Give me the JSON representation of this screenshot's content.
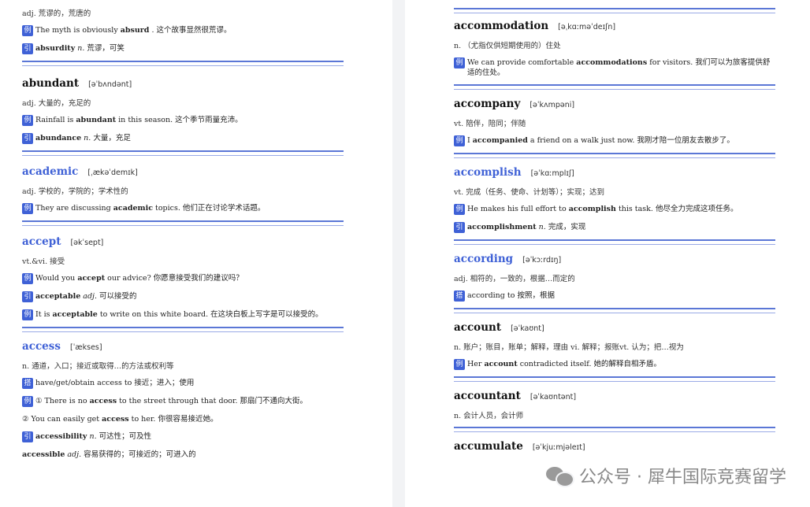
{
  "left": {
    "top_def": "adj. 荒谬的，荒唐的",
    "top_ex": {
      "tag": "例",
      "pre": "The myth is obviously ",
      "bold": "absurd",
      "post": " . 这个故事显然很荒谬。"
    },
    "top_der": {
      "tag": "引",
      "bold": "absurdity",
      "pos": " n.",
      "post": " 荒谬，可笑"
    },
    "abundant": {
      "word": "abundant",
      "ipa": "[əˈbʌndənt]",
      "def": "adj. 大量的，充足的",
      "ex": {
        "tag": "例",
        "pre": "Rainfall is ",
        "bold": "abundant",
        "post": " in this season. 这个季节雨量充沛。"
      },
      "der": {
        "tag": "引",
        "bold": "abundance",
        "pos": " n.",
        "post": " 大量，充足"
      }
    },
    "academic": {
      "word": "academic",
      "ipa": "[ˌækəˈdemɪk]",
      "def": "adj. 学校的，学院的；学术性的",
      "ex": {
        "tag": "例",
        "pre": "They are discussing ",
        "bold": "academic",
        "post": " topics. 他们正在讨论学术话题。"
      }
    },
    "accept": {
      "word": "accept",
      "ipa": "[əkˈsept]",
      "def": "vt.&vi. 接受",
      "ex": {
        "tag": "例",
        "pre": "Would you ",
        "bold": "accept",
        "post": " our advice? 你愿意接受我们的建议吗？"
      },
      "der": {
        "tag": "引",
        "bold": "acceptable",
        "pos": " adj.",
        "post": " 可以接受的"
      },
      "ex2": {
        "tag": "例",
        "pre": "It is ",
        "bold": "acceptable",
        "post": " to write on this white board. 在这块白板上写字是可以接受的。"
      }
    },
    "access": {
      "word": "access",
      "ipa": "[ˈækses]",
      "def": "n. 通道，入口；接近或取得…的方法或权利等",
      "col": {
        "tag": "搭",
        "text": "have/get/obtain access to 接近；进入；使用"
      },
      "ex": {
        "tag": "例",
        "pre": "① There is no ",
        "bold": "access",
        "post": " to the street through that door. 那扇门不通向大街。"
      },
      "ex_b": {
        "pre": "② You can easily get ",
        "bold": "access",
        "post": " to her. 你很容易接近她。"
      },
      "der": {
        "tag": "引",
        "bold": "accessibility",
        "pos": " n.",
        "post": " 可达性；可及性"
      },
      "der2": {
        "bold": "accessible",
        "pos": " adj.",
        "post": " 容易获得的；可接近的；可进入的"
      }
    }
  },
  "right": {
    "accommodation": {
      "word": "accommodation",
      "ipa": "[əˌkɑːməˈdeɪʃn]",
      "def": "n. （尤指仅供短期使用的）住处",
      "ex": {
        "tag": "例",
        "pre": "We can provide comfortable ",
        "bold": "accommodations",
        "post": " for visitors. 我们可以为旅客提供舒适的住处。"
      }
    },
    "accompany": {
      "word": "accompany",
      "ipa": "[əˈkʌmpəni]",
      "def": "vt. 陪伴，陪同；伴随",
      "ex": {
        "tag": "例",
        "pre": "I ",
        "bold": "accompanied",
        "post": " a friend on a walk just now. 我刚才陪一位朋友去散步了。"
      }
    },
    "accomplish": {
      "word": "accomplish",
      "ipa": "[əˈkɑːmplɪʃ]",
      "def": "vt. 完成（任务、使命、计划等）；实现；达到",
      "ex": {
        "tag": "例",
        "pre": "He makes his full effort to ",
        "bold": "accomplish",
        "post": " this task. 他尽全力完成这项任务。"
      },
      "der": {
        "tag": "引",
        "bold": "accomplishment",
        "pos": " n.",
        "post": " 完成，实现"
      }
    },
    "according": {
      "word": "according",
      "ipa": "[əˈkɔːrdɪŋ]",
      "def": "adj. 相符的，一致的，根据…而定的",
      "col": {
        "tag": "搭",
        "text": "according to 按照，根据"
      }
    },
    "account": {
      "word": "account",
      "ipa": "[əˈkaʊnt]",
      "def": "n. 账户；账目，账单；解释，理由 vi. 解释；报账vt. 认为；把…视为",
      "ex": {
        "tag": "例",
        "pre": "Her ",
        "bold": "account",
        "post": " contradicted itself. 她的解释自相矛盾。"
      }
    },
    "accountant": {
      "word": "accountant",
      "ipa": "[əˈkaʊntənt]",
      "def": "n. 会计人员，会计师"
    },
    "accumulate": {
      "word": "accumulate",
      "ipa": "[əˈkjuːmjəleɪt]"
    }
  },
  "watermark": "公众号 · 犀牛国际竞赛留学"
}
